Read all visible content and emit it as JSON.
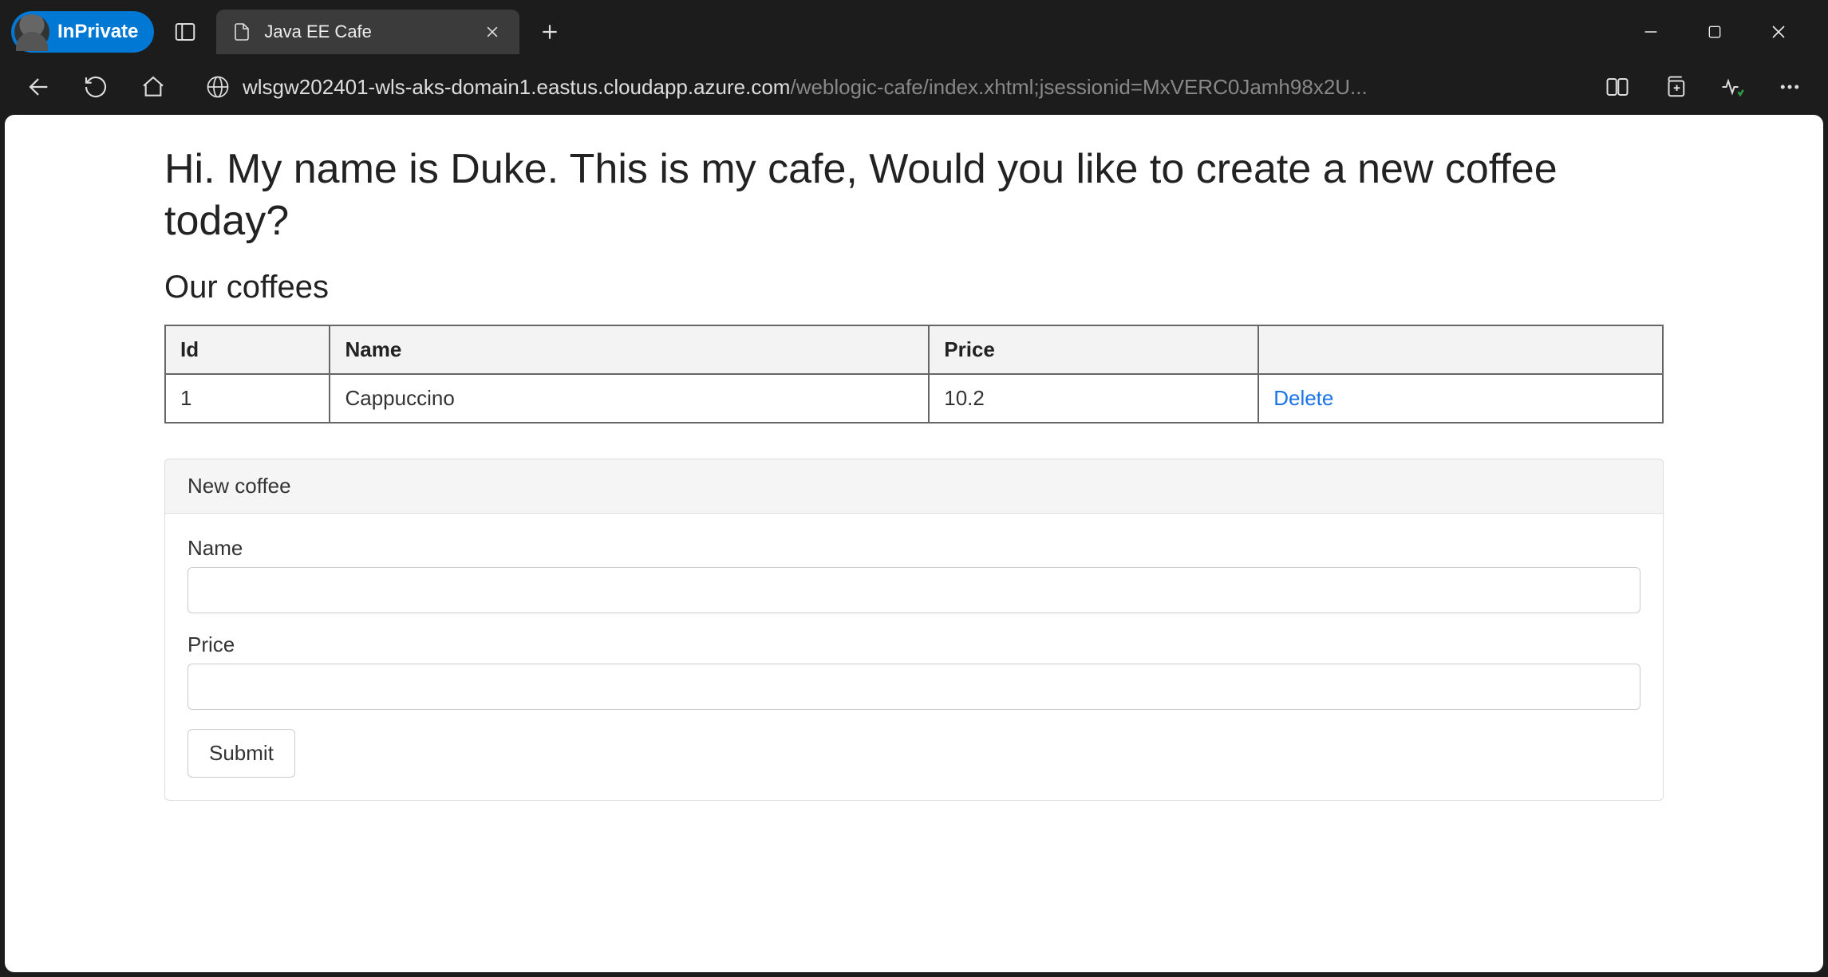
{
  "browser": {
    "inprivate_label": "InPrivate",
    "tab_title": "Java EE Cafe",
    "url_host": "wlsgw202401-wls-aks-domain1.eastus.cloudapp.azure.com",
    "url_path": "/weblogic-cafe/index.xhtml;jsessionid=MxVERC0Jamh98x2U..."
  },
  "page": {
    "heading": "Hi. My name is Duke. This is my cafe, Would you like to create a new coffee today?",
    "section_title": "Our coffees",
    "table": {
      "headers": {
        "id": "Id",
        "name": "Name",
        "price": "Price",
        "actions": ""
      },
      "rows": [
        {
          "id": "1",
          "name": "Cappuccino",
          "price": "10.2",
          "delete_label": "Delete"
        }
      ]
    },
    "form": {
      "panel_title": "New coffee",
      "name_label": "Name",
      "name_value": "",
      "price_label": "Price",
      "price_value": "",
      "submit_label": "Submit"
    }
  }
}
